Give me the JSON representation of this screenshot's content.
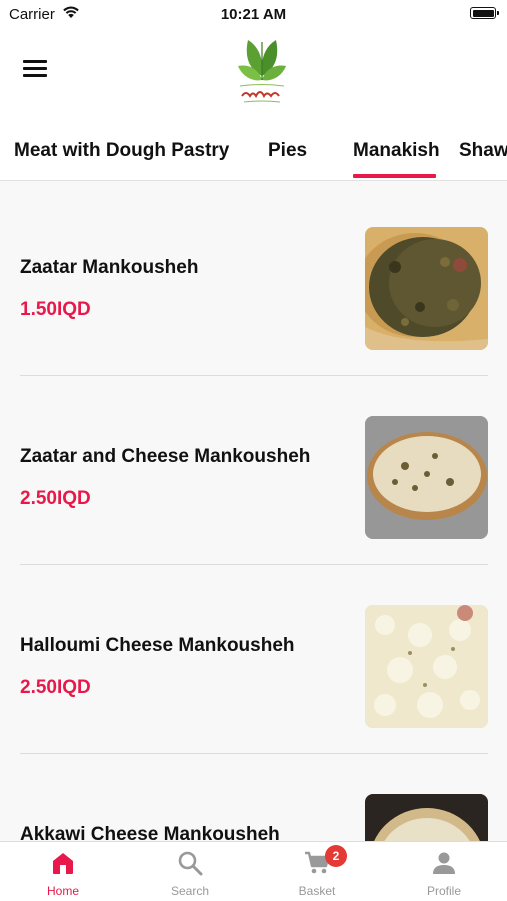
{
  "status_bar": {
    "carrier": "Carrier",
    "time": "10:21 AM"
  },
  "header": {
    "menu_icon": "hamburger-icon",
    "logo_icon": "leaf-logo-icon"
  },
  "category_tabs": [
    {
      "label": "Meat with Dough Pastry",
      "active": false
    },
    {
      "label": "Pies",
      "active": false
    },
    {
      "label": "Manakish",
      "active": true
    },
    {
      "label": "Shaw",
      "active": false
    }
  ],
  "products": [
    {
      "name": "Zaatar Mankousheh",
      "price": "1.50IQD",
      "image_icon": "zaatar-manakish-photo"
    },
    {
      "name": "Zaatar and Cheese Mankousheh",
      "price": "2.50IQD",
      "image_icon": "zaatar-cheese-manakish-photo"
    },
    {
      "name": "Halloumi Cheese Mankousheh",
      "price": "2.50IQD",
      "image_icon": "halloumi-manakish-photo"
    },
    {
      "name": "Akkawi Cheese Mankousheh",
      "price": "",
      "image_icon": "akkawi-manakish-photo"
    }
  ],
  "tab_bar": [
    {
      "label": "Home",
      "icon": "home-icon",
      "active": true
    },
    {
      "label": "Search",
      "icon": "search-icon",
      "active": false
    },
    {
      "label": "Basket",
      "icon": "cart-icon",
      "active": false,
      "badge": "2"
    },
    {
      "label": "Profile",
      "icon": "person-icon",
      "active": false
    }
  ],
  "colors": {
    "accent": "#e8194a",
    "badge": "#e53935",
    "inactive": "#999999"
  }
}
